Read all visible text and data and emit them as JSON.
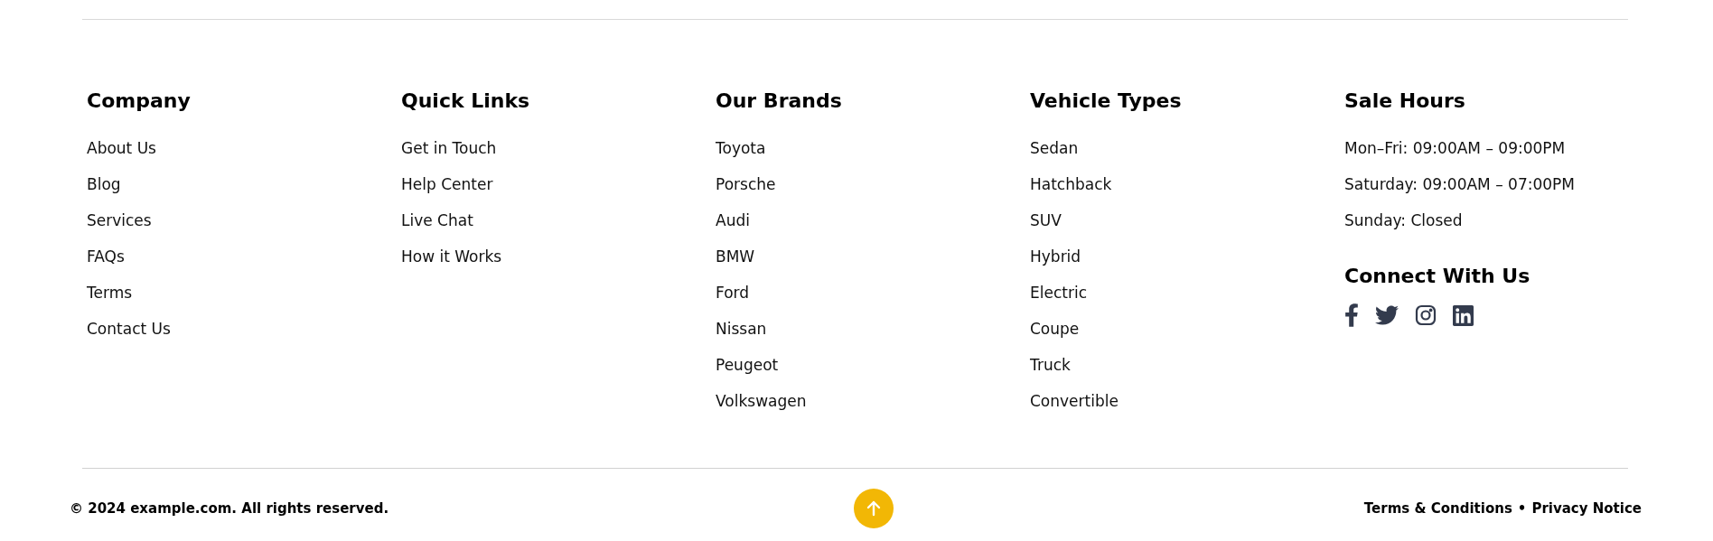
{
  "columns": [
    {
      "heading": "Company",
      "links": [
        "About Us",
        "Blog",
        "Services",
        "FAQs",
        "Terms",
        "Contact Us"
      ]
    },
    {
      "heading": "Quick Links",
      "links": [
        "Get in Touch",
        "Help Center",
        "Live Chat",
        "How it Works"
      ]
    },
    {
      "heading": "Our Brands",
      "links": [
        "Toyota",
        "Porsche",
        "Audi",
        "BMW",
        "Ford",
        "Nissan",
        "Peugeot",
        "Volkswagen"
      ]
    },
    {
      "heading": "Vehicle Types",
      "links": [
        "Sedan",
        "Hatchback",
        "SUV",
        "Hybrid",
        "Electric",
        "Coupe",
        "Truck",
        "Convertible"
      ]
    }
  ],
  "sale_hours": {
    "heading": "Sale Hours",
    "lines": [
      "Mon–Fri: 09:00AM – 09:00PM",
      "Saturday: 09:00AM – 07:00PM",
      "Sunday: Closed"
    ]
  },
  "connect": {
    "heading": "Connect With Us",
    "socials": [
      {
        "kind": "facebook"
      },
      {
        "kind": "twitter"
      },
      {
        "kind": "instagram"
      },
      {
        "kind": "linkedin"
      }
    ]
  },
  "bottom_bar": {
    "copyright": "© 2024 example.com. All rights reserved.",
    "links": [
      "Terms & Conditions",
      "Privacy Notice"
    ],
    "separator": "•"
  }
}
